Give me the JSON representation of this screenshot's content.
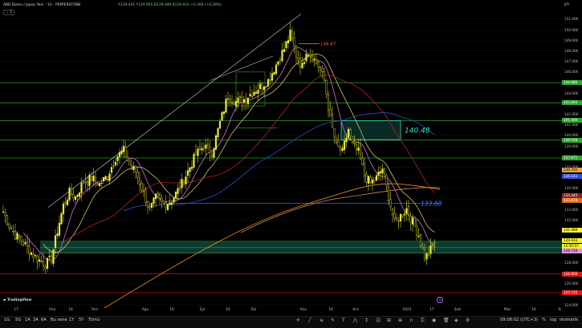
{
  "header": {
    "title": "ABD Doları / Japon Yeni · 1G · PEPPERSTONE",
    "ohlc": "A129.441 Y129.955 D129.040 K129.933 +0.360 (+0.28%)",
    "indicator_count": "2",
    "currency": "JPY"
  },
  "colors": {
    "background": "#000000",
    "candle": "#f2f230",
    "horizontal_lines": "#2fa52f",
    "support_zone": "#0f6b5a",
    "red_line": "#e01818",
    "blue_line": "#3050e0",
    "annotation_teal": "#30e0c0"
  },
  "price_axis": {
    "labels": [
      "151.000",
      "150.000",
      "149.000",
      "148.000",
      "147.000",
      "146.000",
      "145.000",
      "144.000",
      "143.000",
      "142.000",
      "141.000",
      "140.000",
      "139.000",
      "138.000",
      "137.000",
      "136.000",
      "135.000",
      "134.000",
      "133.000",
      "132.000",
      "131.000",
      "130.000",
      "129.000",
      "128.000",
      "127.000",
      "126.000",
      "125.000",
      "124.000"
    ]
  },
  "price_tags": [
    {
      "value": "144.989",
      "color": "#2fa52f",
      "text_color": "#ffffff"
    },
    {
      "value": "143.093",
      "color": "#2fa52f",
      "text_color": "#ffffff"
    },
    {
      "value": "141.400",
      "color": "#2fa52f",
      "text_color": "#ffffff"
    },
    {
      "value": "139.558",
      "color": "#2fa52f",
      "text_color": "#ffffff"
    },
    {
      "value": "137.871",
      "color": "#2fa52f",
      "text_color": "#ffffff"
    },
    {
      "value": "136.705",
      "color": "#e8a040",
      "text_color": "#000000"
    },
    {
      "value": "136.142",
      "color": "#3050e0",
      "text_color": "#ffffff"
    },
    {
      "value": "134.345",
      "color": "#8b2020",
      "text_color": "#ffffff"
    },
    {
      "value": "133.878",
      "color": "#e07010",
      "text_color": "#ffffff"
    },
    {
      "value": "131.089",
      "color": "#f2f230",
      "text_color": "#000000"
    },
    {
      "value": "129.933",
      "color": "#f2f230",
      "text_color": "#000000"
    },
    {
      "value": "15:50:57",
      "color": "#f2f230",
      "text_color": "#000000"
    },
    {
      "value": "129.720",
      "color": "#e890e0",
      "text_color": "#000000"
    },
    {
      "value": "126.909",
      "color": "#e01818",
      "text_color": "#ffffff"
    },
    {
      "value": "125.155",
      "color": "#e01818",
      "text_color": "#ffffff"
    }
  ],
  "annotations": {
    "top_level": "148.67",
    "mid_level": "140.48",
    "low_level": "133.60"
  },
  "time_axis": {
    "labels": [
      "17",
      "Haz",
      "16",
      "Tem",
      "Ağu",
      "16",
      "Eyl",
      "16",
      "Eki",
      "Kas",
      "16",
      "Ara",
      "2023",
      "17",
      "Şub",
      "Mar",
      "16",
      "N"
    ]
  },
  "bottom_bar": {
    "timeframes": [
      "1G",
      "5G",
      "1A",
      "3A",
      "6A",
      "Bu sene",
      "1Y",
      "5Y",
      "Tümü"
    ],
    "clock": "09:08:02 (UTC+3)",
    "scale_pct": "%",
    "scale_log": "log",
    "scale_auto": "otomatik"
  },
  "chart_data": {
    "type": "candlestick",
    "symbol": "USDJPY",
    "interval": "1D",
    "ylim": [
      123.7,
      152.2
    ],
    "x_ticks": [
      "17",
      "Haz",
      "16",
      "Tem",
      "Ağu",
      "16",
      "Eyl",
      "16",
      "Eki",
      "Kas",
      "16",
      "Ara",
      "2023",
      "17",
      "Şub",
      "Mar",
      "16",
      "N"
    ],
    "close_path": [
      [
        0,
        132.8
      ],
      [
        3,
        131.5
      ],
      [
        6,
        130.6
      ],
      [
        9,
        130.1
      ],
      [
        12,
        129.4
      ],
      [
        15,
        128.7
      ],
      [
        18,
        128.2
      ],
      [
        21,
        127.8
      ],
      [
        24,
        128.4
      ],
      [
        27,
        131.0
      ],
      [
        30,
        133.4
      ],
      [
        33,
        134.6
      ],
      [
        36,
        134.2
      ],
      [
        40,
        135.6
      ],
      [
        44,
        136.0
      ],
      [
        48,
        135.4
      ],
      [
        52,
        136.2
      ],
      [
        56,
        137.9
      ],
      [
        60,
        138.6
      ],
      [
        63,
        137.2
      ],
      [
        66,
        136.6
      ],
      [
        70,
        134.5
      ],
      [
        73,
        132.9
      ],
      [
        76,
        134.1
      ],
      [
        80,
        133.5
      ],
      [
        84,
        133.9
      ],
      [
        88,
        135.1
      ],
      [
        92,
        136.6
      ],
      [
        96,
        138.2
      ],
      [
        100,
        139.0
      ],
      [
        104,
        138.4
      ],
      [
        108,
        141.2
      ],
      [
        112,
        143.8
      ],
      [
        116,
        143.2
      ],
      [
        120,
        143.4
      ],
      [
        124,
        144.1
      ],
      [
        128,
        144.6
      ],
      [
        132,
        145.2
      ],
      [
        136,
        146.7
      ],
      [
        140,
        148.2
      ],
      [
        143,
        149.6
      ],
      [
        146,
        147.6
      ],
      [
        149,
        146.5
      ],
      [
        151,
        148.1
      ],
      [
        154,
        147.4
      ],
      [
        157,
        146.6
      ],
      [
        160,
        145.2
      ],
      [
        163,
        141.5
      ],
      [
        166,
        139.0
      ],
      [
        169,
        138.4
      ],
      [
        172,
        140.6
      ],
      [
        174,
        139.1
      ],
      [
        177,
        138.4
      ],
      [
        180,
        136.2
      ],
      [
        183,
        135.5
      ],
      [
        186,
        136.0
      ],
      [
        189,
        136.9
      ],
      [
        192,
        134.2
      ],
      [
        195,
        131.7
      ],
      [
        198,
        132.4
      ],
      [
        201,
        133.1
      ],
      [
        204,
        131.8
      ],
      [
        207,
        130.6
      ],
      [
        210,
        128.4
      ],
      [
        212,
        128.9
      ],
      [
        215,
        129.9
      ]
    ]
  }
}
